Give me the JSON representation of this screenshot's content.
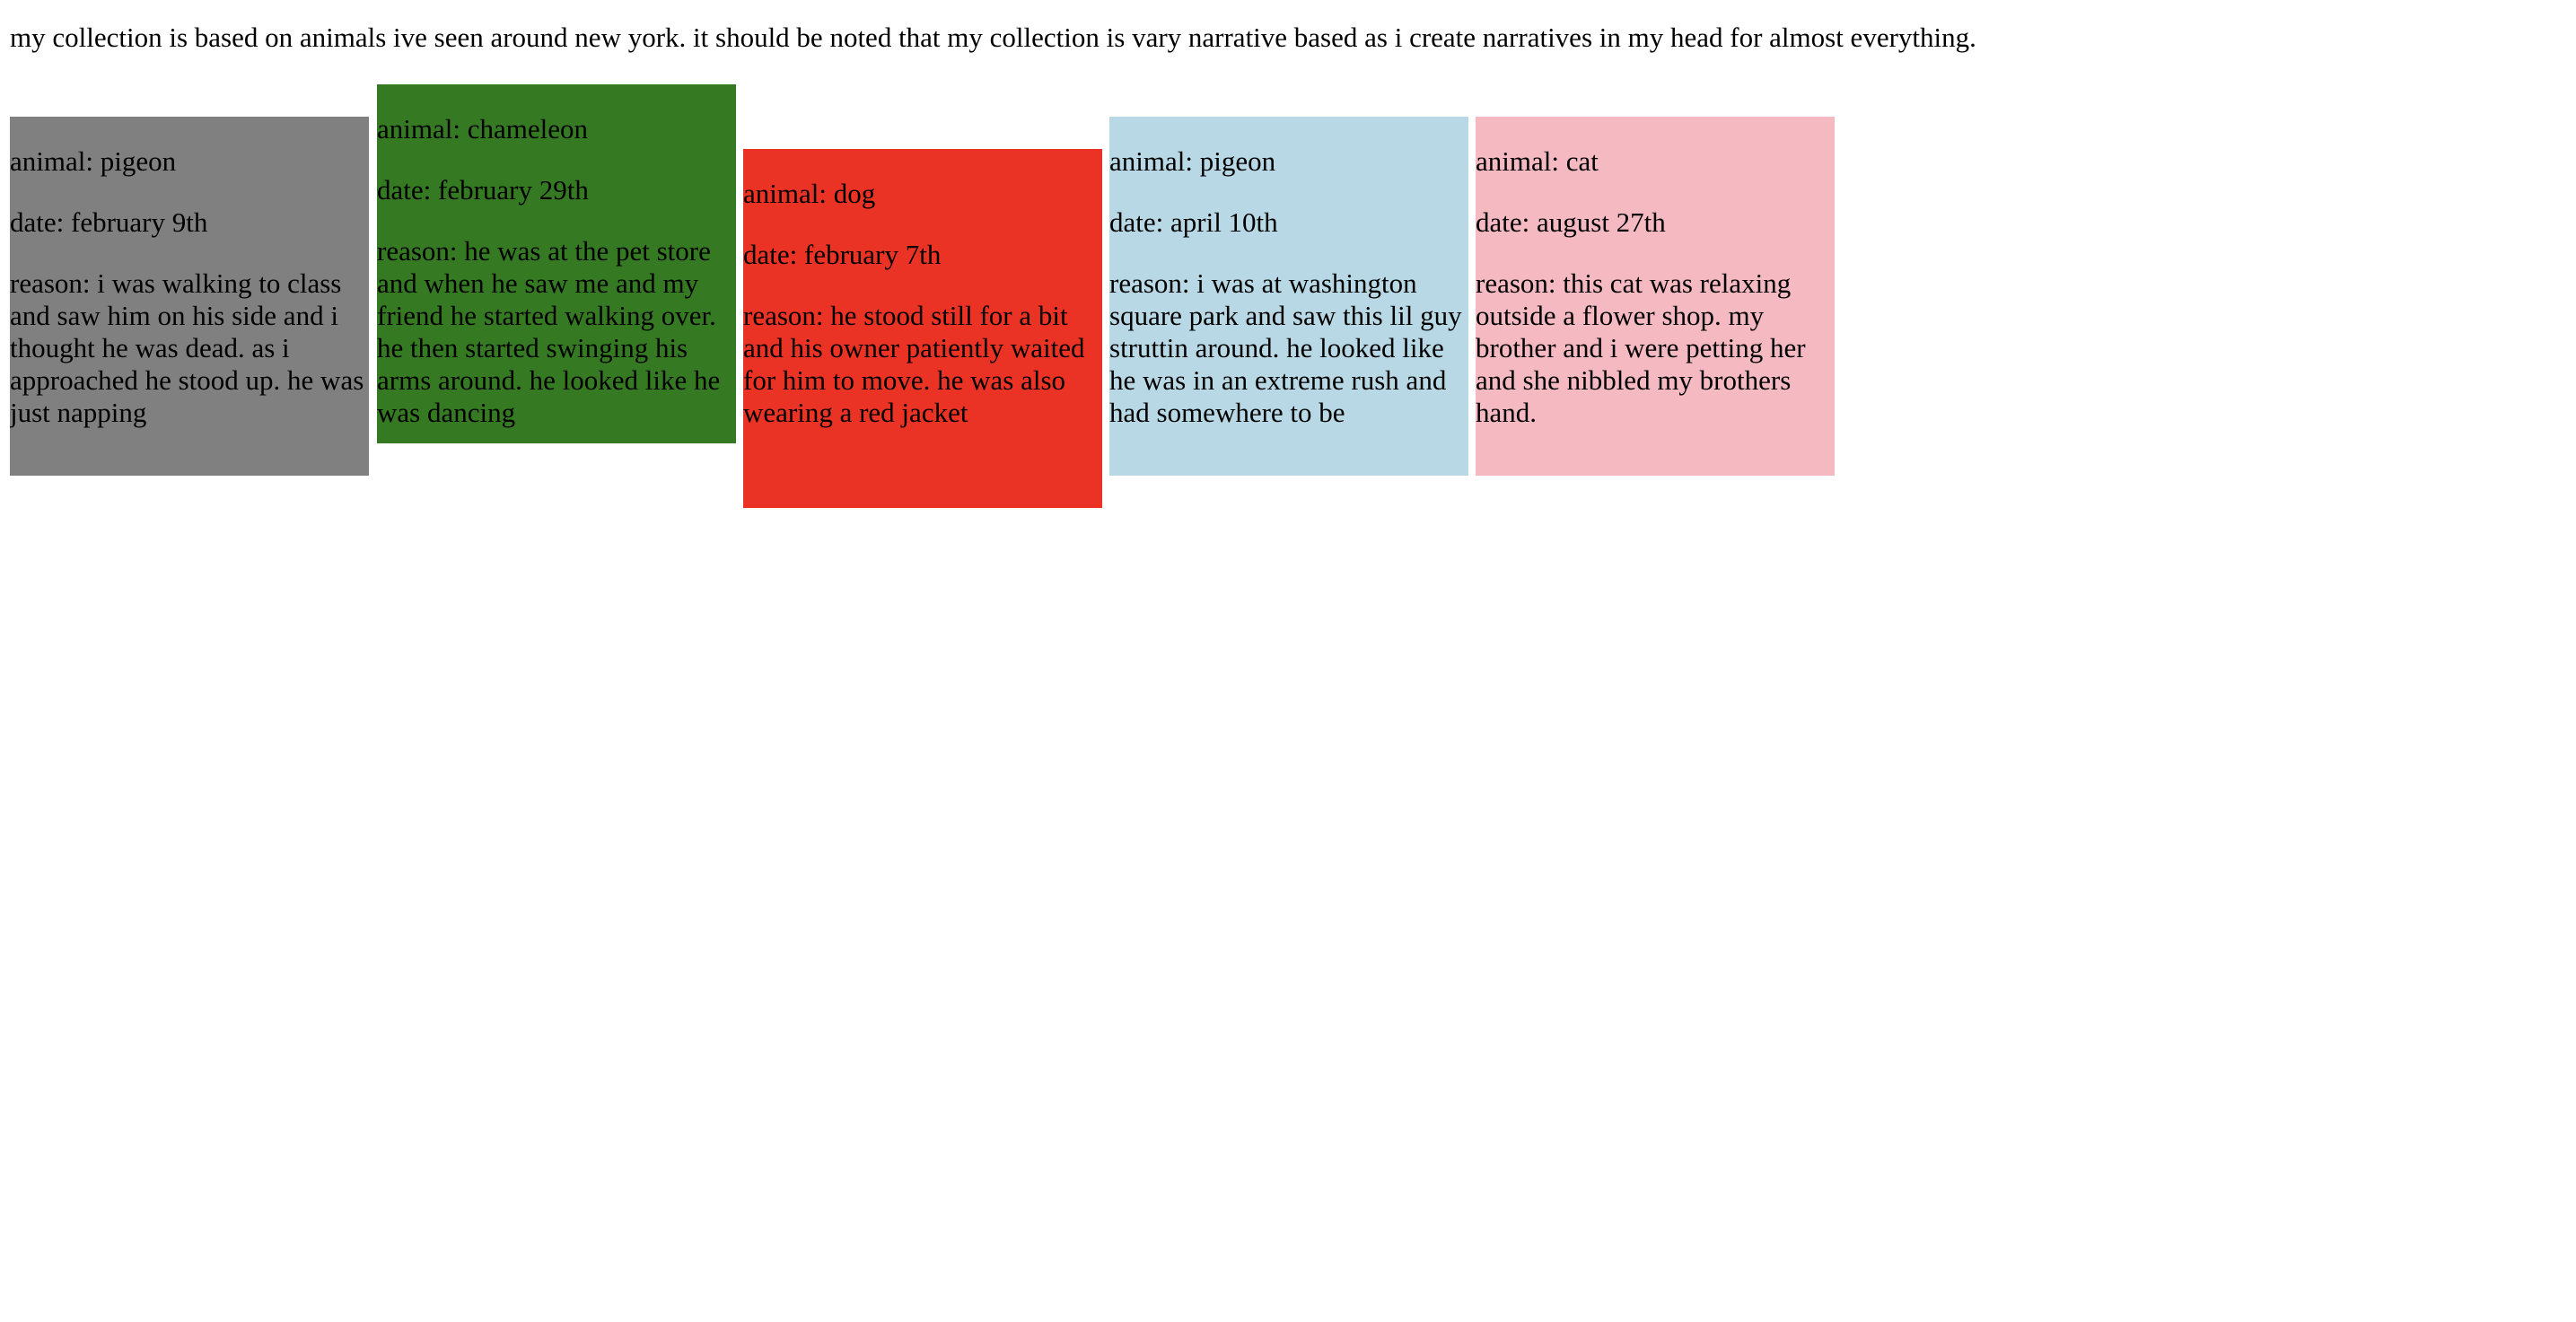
{
  "intro": "my collection is based on animals ive seen around new york. it should be noted that my collection is vary narrative based as i create narratives in my head for almost everything.",
  "cards": [
    {
      "animal": "animal: pigeon",
      "date": "date: february 9th",
      "reason": "reason: i was walking to class and saw him on his side and i thought he was dead. as i approached he stood up. he was just napping",
      "color": "#808080"
    },
    {
      "animal": "animal: chameleon",
      "date": "date: february 29th",
      "reason": "reason: he was at the pet store and when he saw me and my friend he started walking over. he then started swinging his arms around. he looked like he was dancing",
      "color": "#357a23"
    },
    {
      "animal": "animal: dog",
      "date": "date: february 7th",
      "reason": "reason: he stood still for a bit and his owner patiently waited for him to move. he was also wearing a red jacket",
      "color": "#ea3324"
    },
    {
      "animal": "animal: pigeon",
      "date": "date: april 10th",
      "reason": "reason: i was at washington square park and saw this lil guy struttin around. he looked like he was in an extreme rush and had somewhere to be",
      "color": "#b7d8e4"
    },
    {
      "animal": "animal: cat",
      "date": "date: august 27th",
      "reason": "reason: this cat was relaxing outside a flower shop. my brother and i were petting her and she nibbled my brothers hand.",
      "color": "#f5b9c2"
    }
  ]
}
